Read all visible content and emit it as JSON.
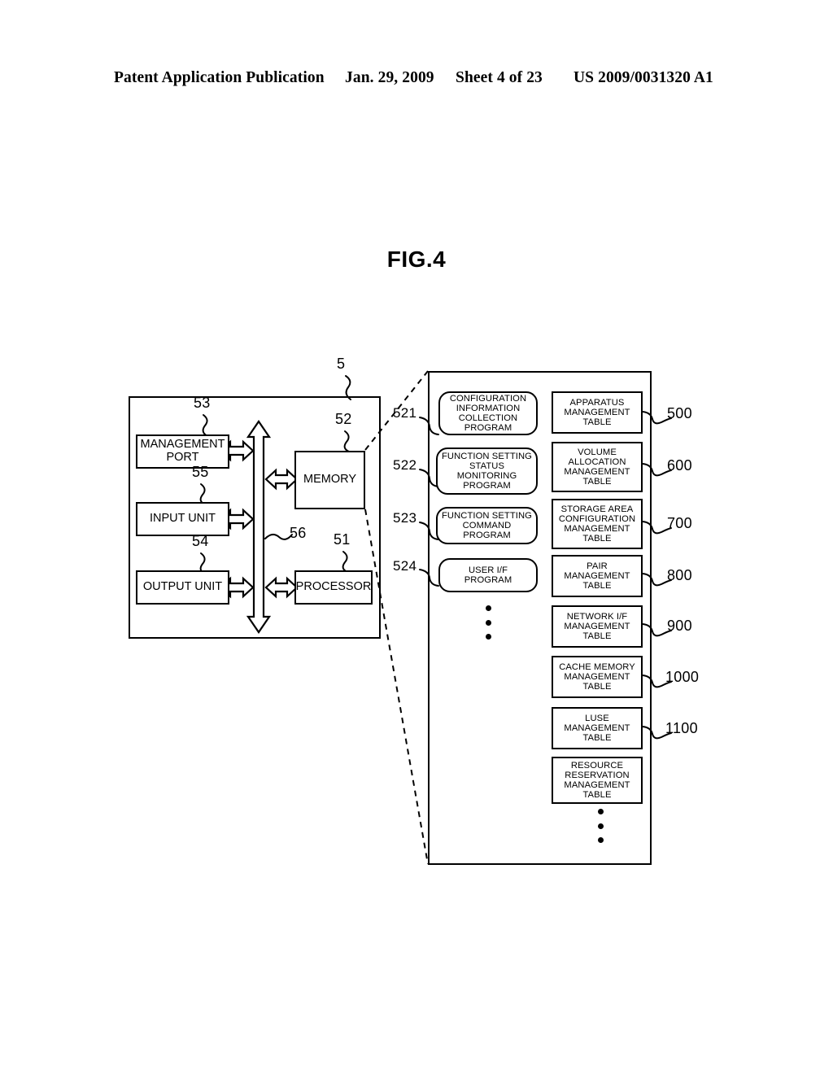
{
  "header": {
    "publication": "Patent Application Publication",
    "date": "Jan. 29, 2009",
    "sheet": "Sheet 4 of 23",
    "patent_number": "US 2009/0031320 A1"
  },
  "figure": {
    "title": "FIG.4",
    "enclosure_ref": "5",
    "units": [
      {
        "ref": "53",
        "label": "MANAGEMENT\nPORT"
      },
      {
        "ref": "55",
        "label": "INPUT UNIT"
      },
      {
        "ref": "54",
        "label": "OUTPUT UNIT"
      },
      {
        "ref": "52",
        "label": "MEMORY"
      },
      {
        "ref": "51",
        "label": "PROCESSOR"
      },
      {
        "ref": "56",
        "label": ""
      }
    ],
    "bus_ref": "56",
    "programs": [
      {
        "ref": "521",
        "label": "CONFIGURATION\nINFORMATION\nCOLLECTION\nPROGRAM"
      },
      {
        "ref": "522",
        "label": "FUNCTION SETTING\nSTATUS\nMONITORING\nPROGRAM"
      },
      {
        "ref": "523",
        "label": "FUNCTION SETTING\nCOMMAND\nPROGRAM"
      },
      {
        "ref": "524",
        "label": "USER I/F\nPROGRAM"
      }
    ],
    "tables": [
      {
        "ref": "500",
        "label": "APPARATUS\nMANAGEMENT\nTABLE"
      },
      {
        "ref": "600",
        "label": "VOLUME\nALLOCATION\nMANAGEMENT\nTABLE"
      },
      {
        "ref": "700",
        "label": "STORAGE AREA\nCONFIGURATION\nMANAGEMENT\nTABLE"
      },
      {
        "ref": "800",
        "label": "PAIR\nMANAGEMENT\nTABLE"
      },
      {
        "ref": "900",
        "label": "NETWORK I/F\nMANAGEMENT\nTABLE"
      },
      {
        "ref": "1000",
        "label": "CACHE MEMORY\nMANAGEMENT\nTABLE"
      },
      {
        "ref": "1100",
        "label": "LUSE\nMANAGEMENT\nTABLE"
      },
      {
        "ref": "",
        "label": "RESOURCE\nRESERVATION\nMANAGEMENT\nTABLE"
      }
    ]
  }
}
